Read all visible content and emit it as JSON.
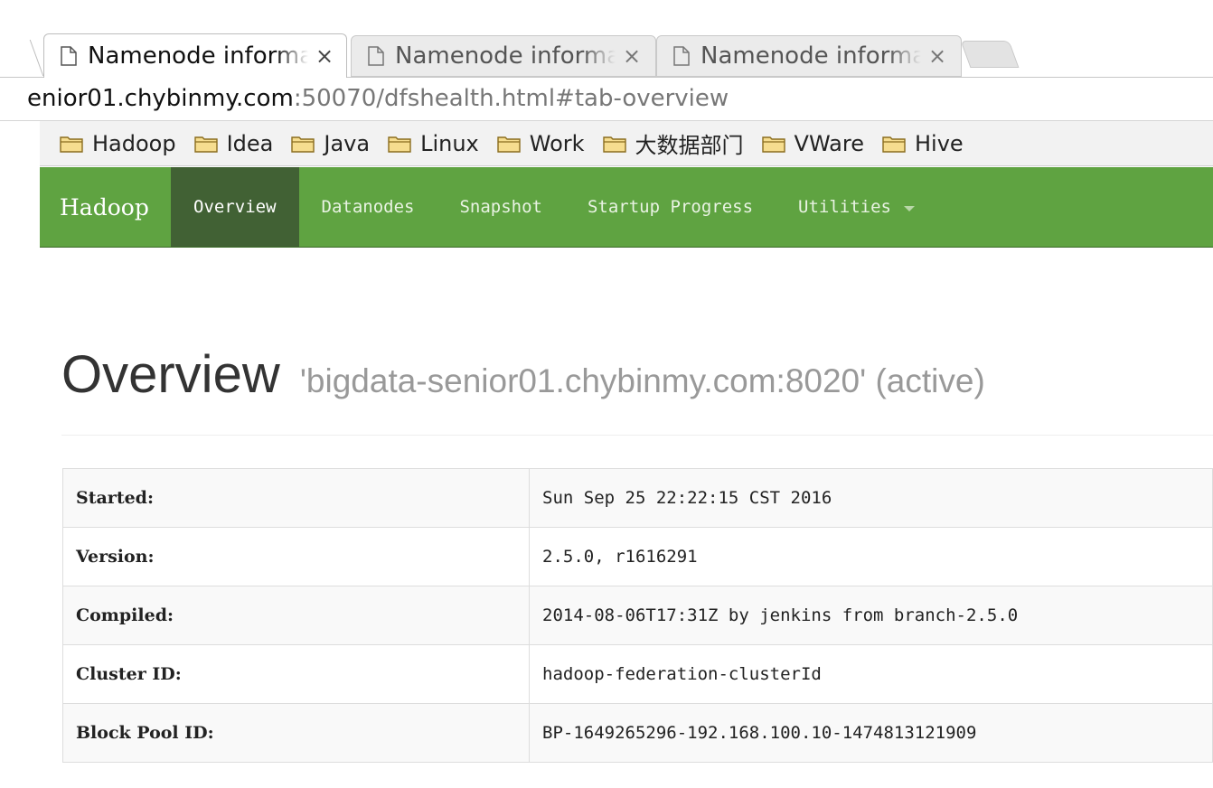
{
  "browser": {
    "tabs": [
      {
        "title": "Namenode information",
        "close": "×",
        "active": true
      },
      {
        "title": "Namenode information",
        "close": "×",
        "active": false
      },
      {
        "title": "Namenode information",
        "close": "×",
        "active": false
      }
    ],
    "url_host": "enior01.chybinmy.com",
    "url_rest": ":50070/dfshealth.html#tab-overview",
    "bookmarks": [
      "Hadoop",
      "Idea",
      "Java",
      "Linux",
      "Work",
      "大数据部门",
      "VWare",
      "Hive"
    ]
  },
  "navbar": {
    "brand": "Hadoop",
    "items": [
      "Overview",
      "Datanodes",
      "Snapshot",
      "Startup Progress",
      "Utilities"
    ],
    "active_index": 0,
    "accent": "#5fa341",
    "active_bg": "#416134"
  },
  "header": {
    "title": "Overview",
    "subtitle": "'bigdata-senior01.chybinmy.com:8020' (active)"
  },
  "info": [
    {
      "label": "Started:",
      "value": "Sun Sep 25 22:22:15 CST 2016"
    },
    {
      "label": "Version:",
      "value": "2.5.0, r1616291"
    },
    {
      "label": "Compiled:",
      "value": "2014-08-06T17:31Z by jenkins from branch-2.5.0"
    },
    {
      "label": "Cluster ID:",
      "value": "hadoop-federation-clusterId"
    },
    {
      "label": "Block Pool ID:",
      "value": "BP-1649265296-192.168.100.10-1474813121909"
    }
  ]
}
